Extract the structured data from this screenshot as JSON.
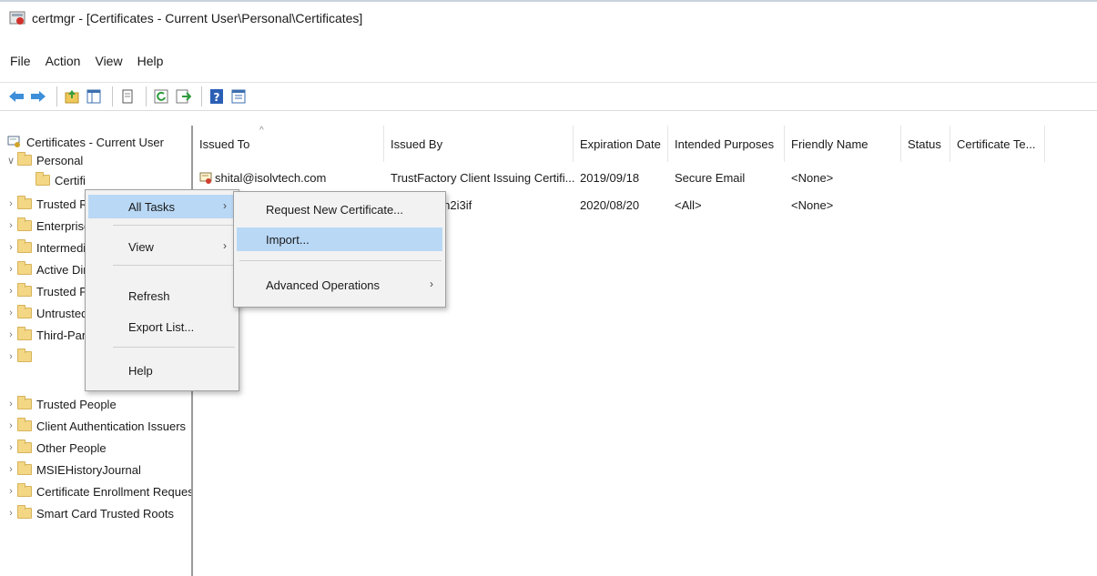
{
  "window": {
    "title": "certmgr - [Certificates - Current User\\Personal\\Certificates]"
  },
  "menubar": {
    "items": [
      "File",
      "Action",
      "View",
      "Help"
    ]
  },
  "toolbar": {
    "icons": [
      "back-arrow-icon",
      "forward-arrow-icon",
      "up-folder-icon",
      "show-hide-tree-icon",
      "delete-icon",
      "refresh-icon",
      "export-list-icon",
      "help-icon",
      "properties-icon"
    ]
  },
  "tree": {
    "root": "Certificates - Current User",
    "personal": "Personal",
    "certificates": "Certifi",
    "items": [
      "Trusted R",
      "Enterprise",
      "Intermedi",
      "Active Dir",
      "Trusted P",
      "Untrusted",
      "Third-Par",
      "Trusted People",
      "Client Authentication Issuers",
      "Other People",
      "MSIEHistoryJournal",
      "Certificate Enrollment Reques",
      "Smart Card Trusted Roots"
    ]
  },
  "list": {
    "columns": [
      "Issued To",
      "Issued By",
      "Expiration Date",
      "Intended Purposes",
      "Friendly Name",
      "Status",
      "Certificate Te..."
    ],
    "rows": [
      {
        "issued_to": "shital@isolvtech.com",
        "issued_by": "TrustFactory Client Issuing Certifi...",
        "expiration": "2019/09/18",
        "purposes": "Secure Email",
        "friendly": "<None>"
      },
      {
        "issued_to": "",
        "issued_by": "MG..n2i3if",
        "expiration": "2020/08/20",
        "purposes": "<All>",
        "friendly": "<None>"
      }
    ]
  },
  "context_menu": {
    "items": [
      "All Tasks",
      "View",
      "Refresh",
      "Export List...",
      "Help"
    ]
  },
  "submenu": {
    "items": [
      "Request New Certificate...",
      "Import...",
      "Advanced Operations"
    ]
  },
  "colors": {
    "highlight": "#b9d8f5",
    "menu_bg": "#f2f2f2"
  }
}
